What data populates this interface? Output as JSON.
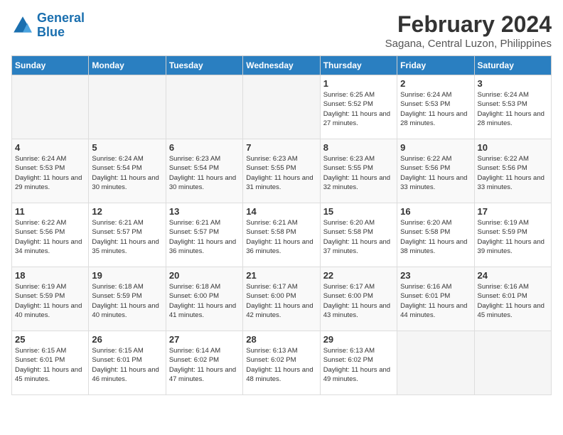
{
  "header": {
    "logo_line1": "General",
    "logo_line2": "Blue",
    "month_year": "February 2024",
    "location": "Sagana, Central Luzon, Philippines"
  },
  "days_of_week": [
    "Sunday",
    "Monday",
    "Tuesday",
    "Wednesday",
    "Thursday",
    "Friday",
    "Saturday"
  ],
  "weeks": [
    [
      {
        "day": "",
        "empty": true
      },
      {
        "day": "",
        "empty": true
      },
      {
        "day": "",
        "empty": true
      },
      {
        "day": "",
        "empty": true
      },
      {
        "day": "1",
        "sunrise": "6:25 AM",
        "sunset": "5:52 PM",
        "daylight": "11 hours and 27 minutes."
      },
      {
        "day": "2",
        "sunrise": "6:24 AM",
        "sunset": "5:53 PM",
        "daylight": "11 hours and 28 minutes."
      },
      {
        "day": "3",
        "sunrise": "6:24 AM",
        "sunset": "5:53 PM",
        "daylight": "11 hours and 28 minutes."
      }
    ],
    [
      {
        "day": "4",
        "sunrise": "6:24 AM",
        "sunset": "5:53 PM",
        "daylight": "11 hours and 29 minutes."
      },
      {
        "day": "5",
        "sunrise": "6:24 AM",
        "sunset": "5:54 PM",
        "daylight": "11 hours and 30 minutes."
      },
      {
        "day": "6",
        "sunrise": "6:23 AM",
        "sunset": "5:54 PM",
        "daylight": "11 hours and 30 minutes."
      },
      {
        "day": "7",
        "sunrise": "6:23 AM",
        "sunset": "5:55 PM",
        "daylight": "11 hours and 31 minutes."
      },
      {
        "day": "8",
        "sunrise": "6:23 AM",
        "sunset": "5:55 PM",
        "daylight": "11 hours and 32 minutes."
      },
      {
        "day": "9",
        "sunrise": "6:22 AM",
        "sunset": "5:56 PM",
        "daylight": "11 hours and 33 minutes."
      },
      {
        "day": "10",
        "sunrise": "6:22 AM",
        "sunset": "5:56 PM",
        "daylight": "11 hours and 33 minutes."
      }
    ],
    [
      {
        "day": "11",
        "sunrise": "6:22 AM",
        "sunset": "5:56 PM",
        "daylight": "11 hours and 34 minutes."
      },
      {
        "day": "12",
        "sunrise": "6:21 AM",
        "sunset": "5:57 PM",
        "daylight": "11 hours and 35 minutes."
      },
      {
        "day": "13",
        "sunrise": "6:21 AM",
        "sunset": "5:57 PM",
        "daylight": "11 hours and 36 minutes."
      },
      {
        "day": "14",
        "sunrise": "6:21 AM",
        "sunset": "5:58 PM",
        "daylight": "11 hours and 36 minutes."
      },
      {
        "day": "15",
        "sunrise": "6:20 AM",
        "sunset": "5:58 PM",
        "daylight": "11 hours and 37 minutes."
      },
      {
        "day": "16",
        "sunrise": "6:20 AM",
        "sunset": "5:58 PM",
        "daylight": "11 hours and 38 minutes."
      },
      {
        "day": "17",
        "sunrise": "6:19 AM",
        "sunset": "5:59 PM",
        "daylight": "11 hours and 39 minutes."
      }
    ],
    [
      {
        "day": "18",
        "sunrise": "6:19 AM",
        "sunset": "5:59 PM",
        "daylight": "11 hours and 40 minutes."
      },
      {
        "day": "19",
        "sunrise": "6:18 AM",
        "sunset": "5:59 PM",
        "daylight": "11 hours and 40 minutes."
      },
      {
        "day": "20",
        "sunrise": "6:18 AM",
        "sunset": "6:00 PM",
        "daylight": "11 hours and 41 minutes."
      },
      {
        "day": "21",
        "sunrise": "6:17 AM",
        "sunset": "6:00 PM",
        "daylight": "11 hours and 42 minutes."
      },
      {
        "day": "22",
        "sunrise": "6:17 AM",
        "sunset": "6:00 PM",
        "daylight": "11 hours and 43 minutes."
      },
      {
        "day": "23",
        "sunrise": "6:16 AM",
        "sunset": "6:01 PM",
        "daylight": "11 hours and 44 minutes."
      },
      {
        "day": "24",
        "sunrise": "6:16 AM",
        "sunset": "6:01 PM",
        "daylight": "11 hours and 45 minutes."
      }
    ],
    [
      {
        "day": "25",
        "sunrise": "6:15 AM",
        "sunset": "6:01 PM",
        "daylight": "11 hours and 45 minutes."
      },
      {
        "day": "26",
        "sunrise": "6:15 AM",
        "sunset": "6:01 PM",
        "daylight": "11 hours and 46 minutes."
      },
      {
        "day": "27",
        "sunrise": "6:14 AM",
        "sunset": "6:02 PM",
        "daylight": "11 hours and 47 minutes."
      },
      {
        "day": "28",
        "sunrise": "6:13 AM",
        "sunset": "6:02 PM",
        "daylight": "11 hours and 48 minutes."
      },
      {
        "day": "29",
        "sunrise": "6:13 AM",
        "sunset": "6:02 PM",
        "daylight": "11 hours and 49 minutes."
      },
      {
        "day": "",
        "empty": true
      },
      {
        "day": "",
        "empty": true
      }
    ]
  ]
}
